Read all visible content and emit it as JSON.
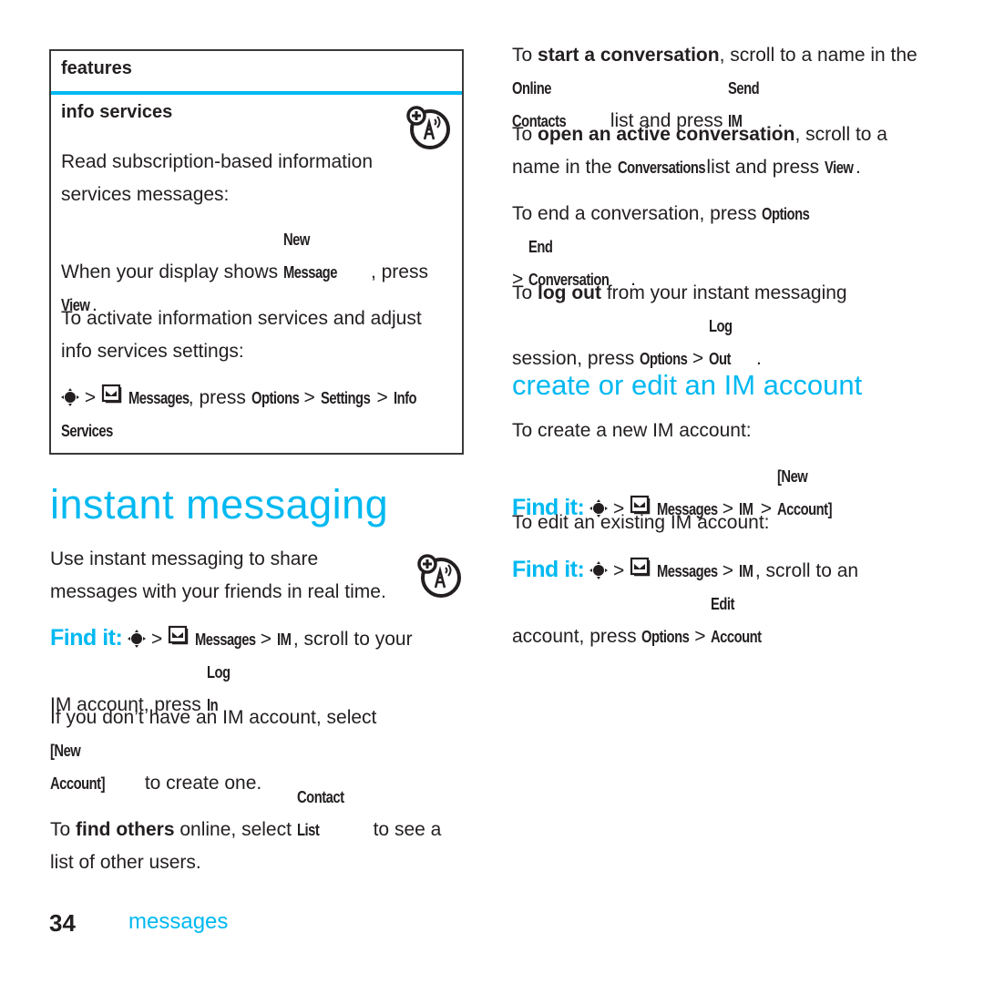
{
  "feature_box": {
    "header": "features",
    "title": "info services",
    "icon": "network-service-icon",
    "paragraphs": {
      "p1": "Read subscription-based information services messages:",
      "p2_pre": "When your display shows ",
      "p2_key1": "New Message",
      "p2_mid": ", press",
      "p2_key2": "View",
      "p2_end": ".",
      "p3": "To activate information services and adjust info services settings:",
      "path_sep": ">",
      "path_messages": "Messages",
      "path_press": ", press ",
      "path_options": "Options",
      "path_settings": "Settings",
      "path_info": "Info",
      "path_services": "Services"
    }
  },
  "section_im": {
    "title": "instant messaging",
    "intro_line1": "Use instant messaging to share",
    "intro_line2": "messages with your friends in real time.",
    "icon": "network-service-icon",
    "findit_label": "Find it:",
    "findit_messages": "Messages",
    "findit_im": "IM",
    "findit_rest1": ", scroll to your",
    "findit_rest2": "IM account, press ",
    "findit_login": "Log In",
    "noaccount_pre": "If you don’t have an IM account, select",
    "noaccount_key": "[New Account]",
    "noaccount_post": " to create one.",
    "findothers_to": "To ",
    "findothers_bold": "find others",
    "findothers_mid": " online, select ",
    "findothers_key": "Contact List",
    "findothers_post": " to see a",
    "findothers_line2": "list of other users."
  },
  "right_col": {
    "start_to": "To ",
    "start_bold": "start a conversation",
    "start_rest": ", scroll to a name in the",
    "start_key1": "Online Contacts",
    "start_mid": " list and press ",
    "start_key2": "Send IM",
    "start_end": ".",
    "open_to": "To ",
    "open_bold": "open an active conversation",
    "open_rest": ", scroll to a",
    "open_line2_pre": "name in the ",
    "open_key1": "Conversations",
    "open_mid": " list and press ",
    "open_key2": "View",
    "open_end": ".",
    "end_pre": "To end a conversation, press ",
    "end_key1": "Options",
    "end_sep": ">",
    "end_key2": "End Conversation",
    "end_end": ".",
    "logout_to": "To ",
    "logout_bold": "log out",
    "logout_rest": " from your instant messaging",
    "logout_line2": "session, press ",
    "logout_key1": "Options",
    "logout_key2": "Log Out",
    "logout_end": ".",
    "create_title": "create or edit an IM account",
    "create_intro": "To create a new IM account:",
    "findit_label": "Find it:",
    "find1_messages": "Messages",
    "find1_im": "IM",
    "find1_new": "[New Account]",
    "edit_intro": "To edit an existing IM account:",
    "find2_messages": "Messages",
    "find2_im": "IM",
    "find2_rest": ", scroll to an",
    "find2_line2": "account, press ",
    "find2_options": "Options",
    "find2_edit": "Edit Account"
  },
  "footer": {
    "page_number": "34",
    "section": "messages"
  },
  "colors": {
    "accent": "#00b9f1",
    "text": "#231f20"
  }
}
